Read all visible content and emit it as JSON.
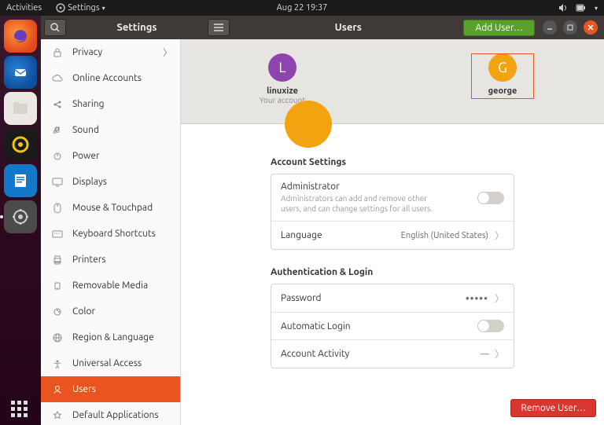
{
  "top_panel": {
    "activities": "Activities",
    "app_menu": "Settings",
    "clock": "Aug 22  19:37"
  },
  "window": {
    "title": "Settings",
    "panel_title": "Users",
    "add_user": "Add User…"
  },
  "sidebar": {
    "items": [
      {
        "label": "Privacy",
        "icon": "lock-icon",
        "chevron": true
      },
      {
        "label": "Online Accounts",
        "icon": "cloud-icon"
      },
      {
        "label": "Sharing",
        "icon": "share-icon"
      },
      {
        "label": "Sound",
        "icon": "music-icon"
      },
      {
        "label": "Power",
        "icon": "power-icon"
      },
      {
        "label": "Displays",
        "icon": "display-icon"
      },
      {
        "label": "Mouse & Touchpad",
        "icon": "mouse-icon"
      },
      {
        "label": "Keyboard Shortcuts",
        "icon": "keyboard-icon"
      },
      {
        "label": "Printers",
        "icon": "printer-icon"
      },
      {
        "label": "Removable Media",
        "icon": "media-icon"
      },
      {
        "label": "Color",
        "icon": "color-icon"
      },
      {
        "label": "Region & Language",
        "icon": "globe-icon"
      },
      {
        "label": "Universal Access",
        "icon": "universal-icon"
      },
      {
        "label": "Users",
        "icon": "users-icon",
        "selected": true
      },
      {
        "label": "Default Applications",
        "icon": "star-icon"
      }
    ]
  },
  "users": {
    "current": {
      "initial": "L",
      "name": "linuxize",
      "subtitle": "Your account"
    },
    "selected": {
      "initial": "G",
      "name": "george"
    }
  },
  "account_settings": {
    "title": "Account Settings",
    "admin_label": "Administrator",
    "admin_desc": "Administrators can add and remove other users, and can change settings for all users.",
    "language_label": "Language",
    "language_value": "English (United States)"
  },
  "auth": {
    "title": "Authentication & Login",
    "password_label": "Password",
    "password_value": "●●●●●",
    "autologin_label": "Automatic Login",
    "activity_label": "Account Activity",
    "activity_value": "—"
  },
  "remove_user": "Remove User…"
}
